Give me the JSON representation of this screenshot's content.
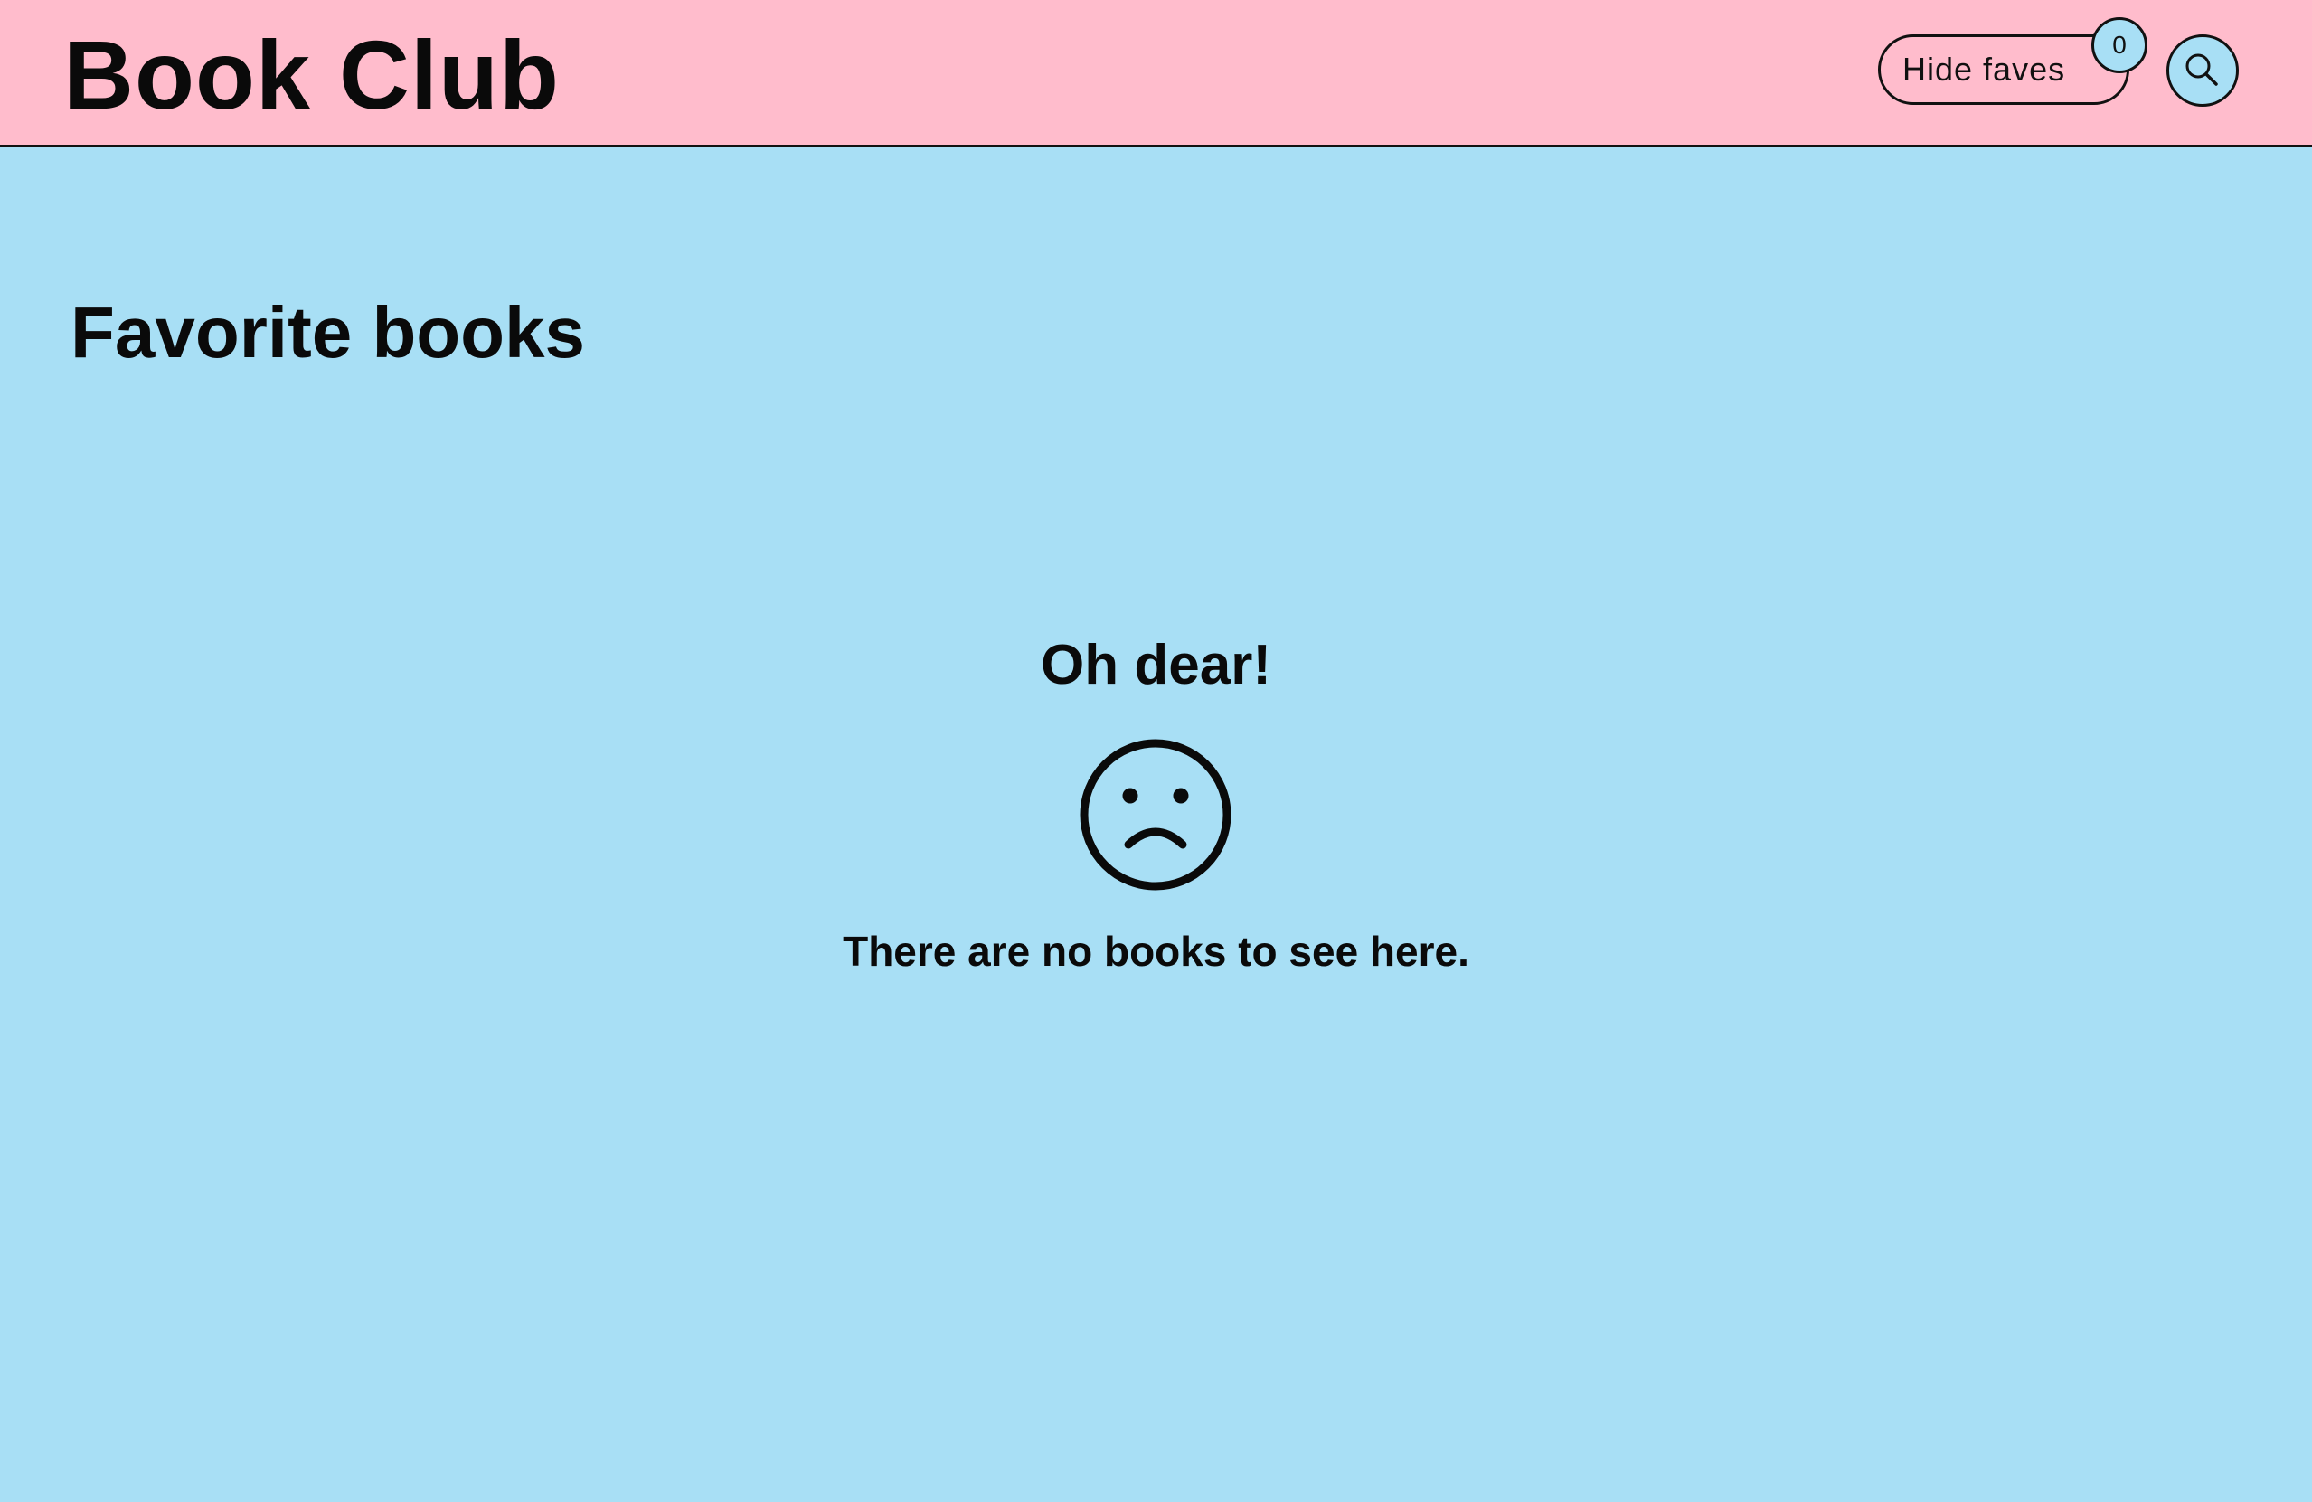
{
  "header": {
    "brand": "Book Club",
    "faves_button_label": "Hide faves",
    "faves_count": "0",
    "search_icon": "search-icon"
  },
  "main": {
    "title": "Favorite books",
    "empty_state": {
      "heading": "Oh dear!",
      "icon": "sad-face-icon",
      "message": "There are no books to see here."
    }
  },
  "colors": {
    "header_bg": "#ffbccc",
    "page_bg": "#a8dff5",
    "text": "#0a0a0a"
  }
}
